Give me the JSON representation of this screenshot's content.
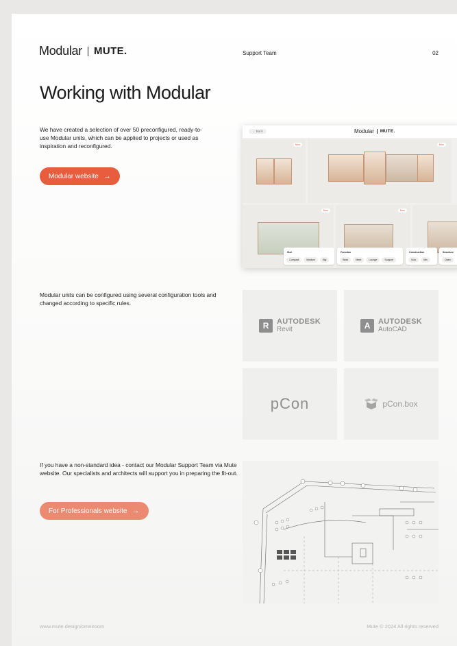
{
  "header": {
    "brand_modular": "Modular",
    "brand_mute": "MUTE.",
    "center_label": "Support Team",
    "page_number": "02"
  },
  "title": "Working with Modular",
  "intro": {
    "text": "We have created a selection of over 50 preconfigured, ready-to-use Modular units, which can be applied to projects or used as inspiration and reconfigured.",
    "button_label": "Modular website",
    "button_color": "#e85d3d"
  },
  "mockup": {
    "back_label": "← Back",
    "title_modular": "Modular",
    "title_mute": "MUTE.",
    "tag_new": "New",
    "filters": [
      {
        "label": "Size",
        "chips": [
          "Compact",
          "Medium",
          "Big"
        ]
      },
      {
        "label": "Function",
        "chips": [
          "Work",
          "Meet",
          "Lounge",
          "Support"
        ]
      },
      {
        "label": "Construction",
        "chips": [
          "Solo",
          "Mix"
        ]
      },
      {
        "label": "Structure",
        "chips": [
          "Open"
        ]
      }
    ]
  },
  "tools": {
    "text": "Modular units can be configured using several configuration tools and changed according to specific rules.",
    "logos": [
      {
        "icon": "R",
        "brand": "AUTODESK",
        "product": "Revit"
      },
      {
        "icon": "A",
        "brand": "AUTODESK",
        "product": "AutoCAD"
      },
      {
        "name": "pCon"
      },
      {
        "name": "pCon.box"
      }
    ]
  },
  "professionals": {
    "text": "If you have a non-standard idea - contact our Modular Support Team via Mute website. Our specialists and architects will support you in preparing the fit-out.",
    "button_label": "For Professionals website",
    "button_color": "#ec8a71"
  },
  "footer": {
    "url": "www.mute.design/omniroom",
    "copyright": "Mute © 2024 All rights reserved"
  }
}
